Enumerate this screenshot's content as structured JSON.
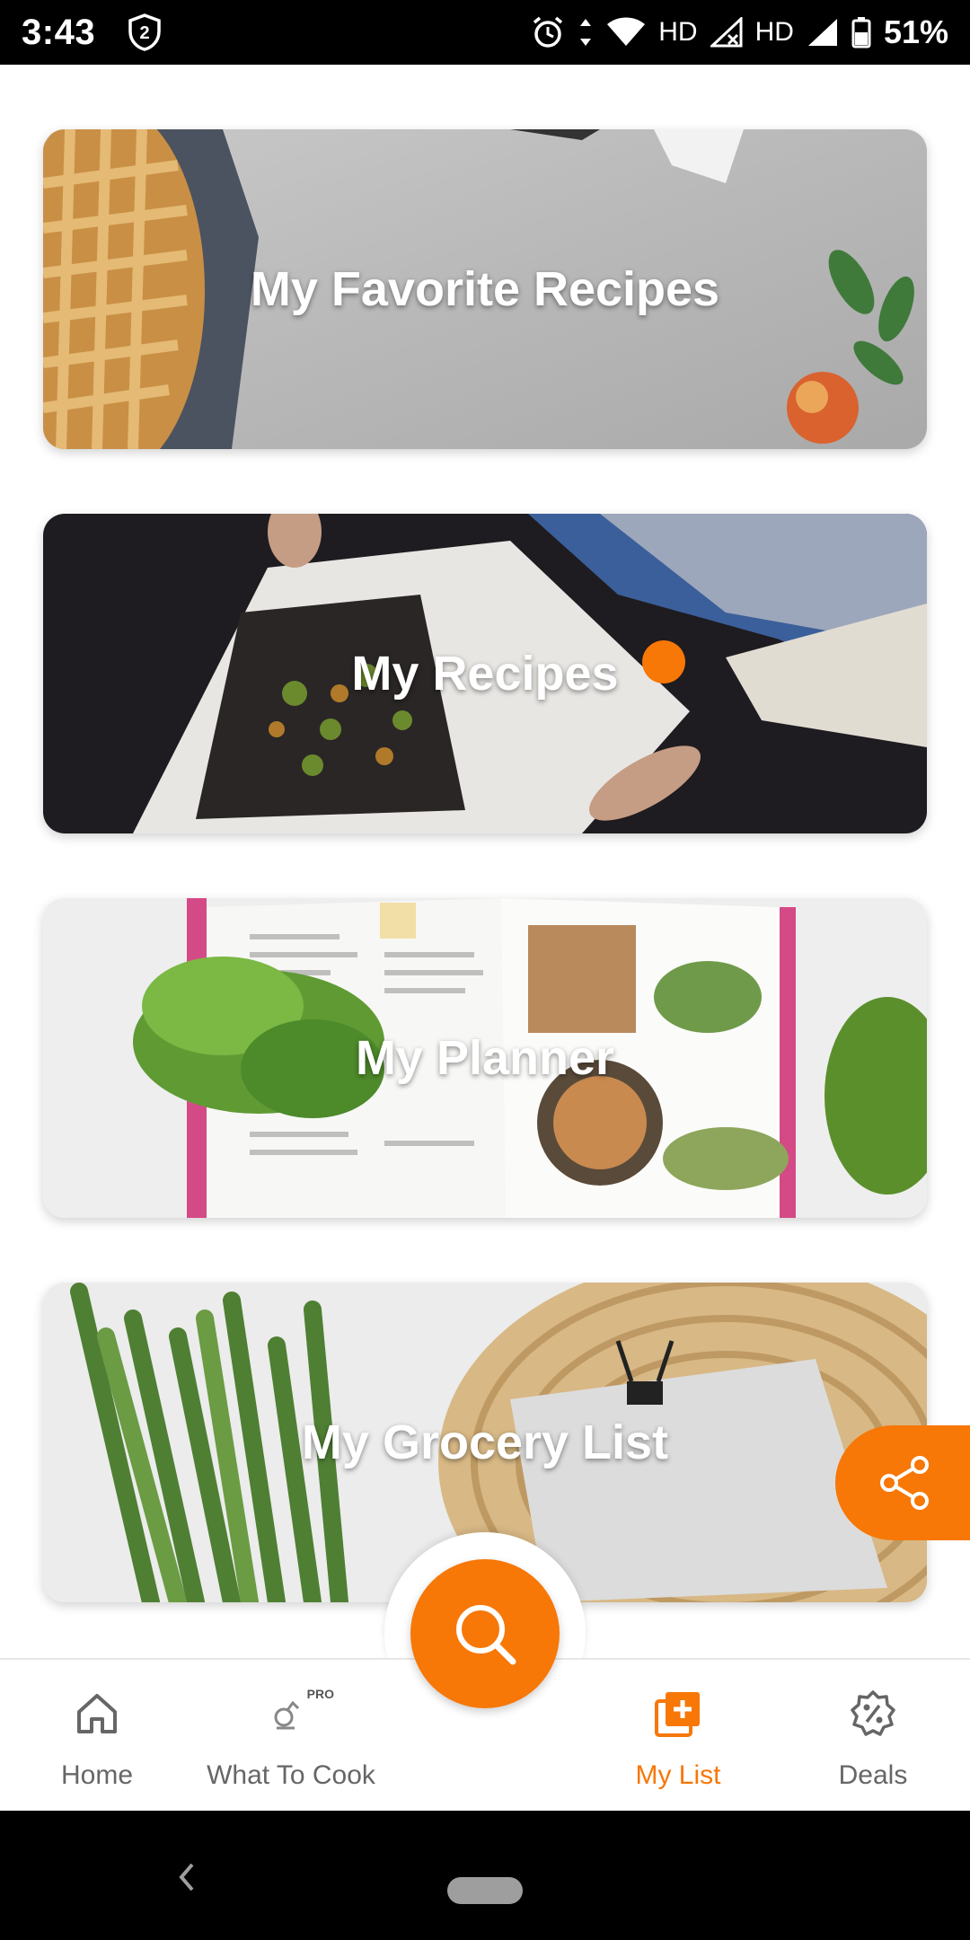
{
  "status_bar": {
    "time": "3:43",
    "notification_badge": "2",
    "hd_1": "HD",
    "hd_2": "HD",
    "battery": "51%"
  },
  "cards": [
    {
      "title": "My Favorite Recipes",
      "image": "pie-on-concrete"
    },
    {
      "title": "My Recipes",
      "image": "cookbook-with-hands",
      "has_notification_dot": true
    },
    {
      "title": "My Planner",
      "image": "open-cookbook-with-kale"
    },
    {
      "title": "My Grocery List",
      "image": "asparagus-with-paper"
    }
  ],
  "bottom_nav": {
    "items": [
      {
        "label": "Home",
        "icon": "home-icon"
      },
      {
        "label": "What To Cook",
        "icon": "what-to-cook-pro-icon",
        "badge": "PRO"
      },
      {
        "label": "My List",
        "icon": "add-list-icon",
        "active": true
      },
      {
        "label": "Deals",
        "icon": "deals-badge-icon"
      }
    ],
    "center_button_icon": "search-icon"
  },
  "share_button_icon": "share-icon",
  "colors": {
    "accent": "#f77707",
    "nav_inactive": "#666666",
    "status_bar_bg": "#000000"
  }
}
